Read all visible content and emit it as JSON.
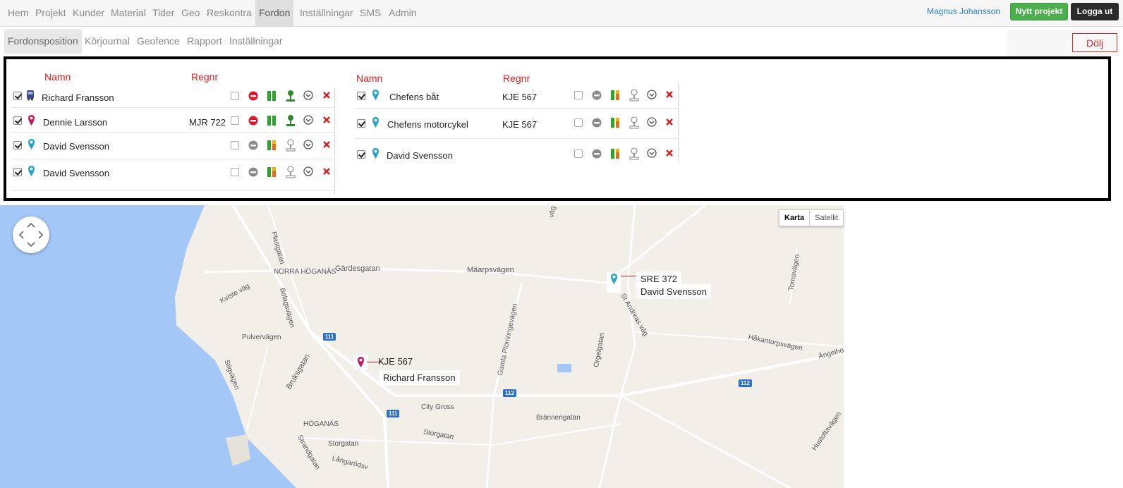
{
  "navbar": {
    "items": [
      "Hem",
      "Projekt",
      "Kunder",
      "Material",
      "Tider",
      "Geo",
      "Reskontra",
      "Fordon",
      "Inställningar",
      "SMS",
      "Admin"
    ],
    "user": "Magnus Johansson",
    "new_project": "Nytt projekt",
    "logout": "Logga ut"
  },
  "subnav": {
    "items": [
      "Fordonsposition",
      "Körjournal",
      "Geofence",
      "Rapport",
      "Inställningar"
    ],
    "hide": "Dölj"
  },
  "panel": {
    "left_header_name": "Namn",
    "left_header_reg": "Regnr",
    "right_header_name": "Namn",
    "right_header_reg": "Regnr",
    "left_rows": [
      {
        "name": "Richard Fransson",
        "reg": ""
      },
      {
        "name": "Dennie Larsson",
        "reg": "MJR 722"
      },
      {
        "name": "David Svensson",
        "reg": ""
      },
      {
        "name": "David Svensson",
        "reg": ""
      }
    ],
    "right_rows": [
      {
        "name": "Chefens båt",
        "reg": "KJE 567"
      },
      {
        "name": "Chefens motorcykel",
        "reg": "KJE 567"
      },
      {
        "name": "David Svensson",
        "reg": ""
      }
    ]
  },
  "map": {
    "btn_map": "Karta",
    "btn_sat": "Satellit",
    "marker1_reg": "KJE 567",
    "marker1_name": "Richard Fransson",
    "marker2_reg": "SRE 372",
    "marker2_name": "David Svensson",
    "places": {
      "norra_hoganas": "NORRA HÖGANÄS",
      "gardesgatan": "Gärdesgatan",
      "maarpsvagen": "Mäarpsvägen",
      "plastgatan": "Plastgatan",
      "kviste": "Kviste väg",
      "bolagsvagen": "Bolagsvägen",
      "pulvervagen": "Pulvervägen",
      "stigvagen": "Stigvägen",
      "bruksgatan": "Bruksgatan",
      "gamla": "Gamla Plöninngevägen",
      "orgelgatan": "Orgelgatan",
      "standreas": "St Andreas väg",
      "hakantorp": "Håkantorpsvägen",
      "tornavagen": "Tornavägen",
      "angelholm": "Ängelho",
      "citygross": "City Gross",
      "brannerigatan": "Brännerigatan",
      "storgatan1": "Storgatan",
      "storgatan2": "Storgatan",
      "hoganas": "HÖGANÄS",
      "strandgatan": "Strandgatan",
      "langarod": "Långarödsv",
      "hustoftavagen": "Hustoftavägen",
      "vag": "väg"
    },
    "routes": {
      "r111a": "111",
      "r111b": "111",
      "r112a": "112",
      "r112b": "112"
    }
  }
}
